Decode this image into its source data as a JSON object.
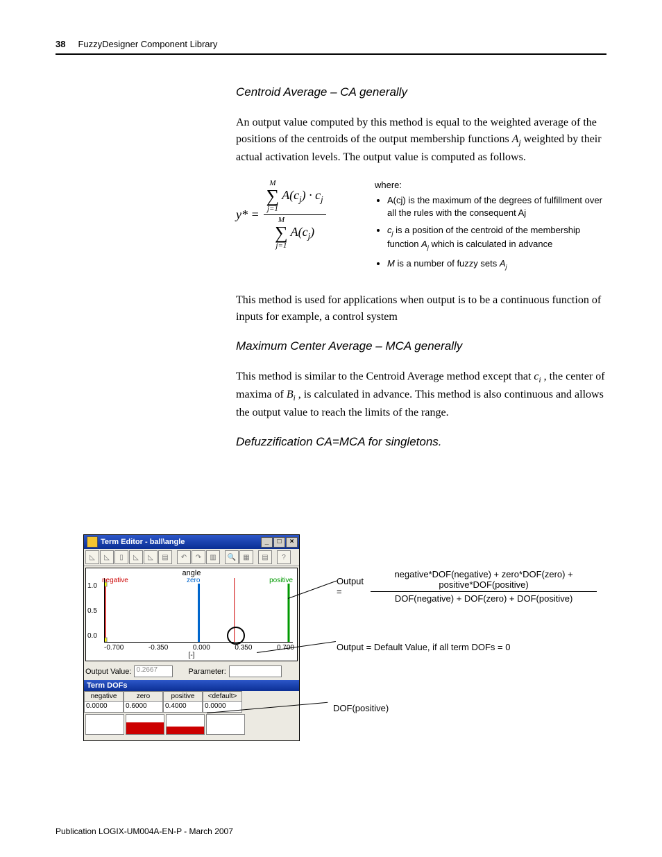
{
  "header": {
    "page": "38",
    "title": "FuzzyDesigner Component Library"
  },
  "s1": {
    "head": "Centroid Average – CA generally",
    "p1a": "An output value computed by this method is equal to the weighted average of the positions of the centroids of the output membership functions ",
    "p1b": " weighted by their actual activation levels. The output value is computed as follows.",
    "aj": "A",
    "ajsub": "j"
  },
  "formula": {
    "ystar": "y* =",
    "sumtop": "M",
    "sumbot": "j=1",
    "num": ") · c",
    "den": ")",
    "Ac": "A(c",
    "sub": "j"
  },
  "where": {
    "lbl": "where:",
    "b1": "A(cj) is the maximum of the degrees of fulfillment over all the rules with the consequent Aj",
    "b2a": "c",
    "b2b": " is a position of the centroid of the membership function ",
    "b2c": "A",
    "b2d": " which is calculated in advance",
    "sub": "j",
    "b3a": "M",
    "b3b": " is a number of fuzzy sets ",
    "b3c": "A",
    "b3sub": "j"
  },
  "s1b": {
    "p": "This method is used for applications when output is to be a continuous function of inputs for example, a control system"
  },
  "s2": {
    "head": "Maximum Center Average – MCA generally",
    "p_a": "This method is similar to the Centroid Average method except that ",
    "ci": "c",
    "cisub": "i",
    "p_b": " , the center of maxima of ",
    "bi": "B",
    "bisub": "i",
    "p_c": " , is calculated in advance. This method is also continuous and allows the output value to reach the limits of the range."
  },
  "s3": {
    "head": "Defuzzification CA=MCA for singletons."
  },
  "win": {
    "title": "Term Editor - ball\\angle",
    "chart_title": "angle",
    "terms": {
      "neg": "negative",
      "zero": "zero",
      "pos": "positive"
    },
    "y": {
      "y1": "1.0",
      "y05": "0.5",
      "y0": "0.0"
    },
    "x": {
      "x1": "-0.700",
      "x2": "-0.350",
      "x3": "0.000",
      "x4": "0.350",
      "x5": "0.700"
    },
    "xunit": "[-]",
    "ov_lbl": "Output Value:",
    "ov": "0.2667",
    "param_lbl": "Parameter:",
    "dofhdr": "Term DOFs",
    "dof": {
      "h1": "negative",
      "h2": "zero",
      "h3": "positive",
      "h4": "<default>",
      "v1": "0.0000",
      "v2": "0.6000",
      "v3": "0.4000",
      "v4": "0.0000"
    }
  },
  "ann": {
    "out_lbl": "Output =",
    "frac_top": "negative*DOF(negative) + zero*DOF(zero) + positive*DOF(positive)",
    "frac_bot": "DOF(negative) + DOF(zero) + DOF(positive)",
    "default": "Output = Default Value, if all term DOFs = 0",
    "dofpos": "DOF(positive)"
  },
  "footer": "Publication LOGIX-UM004A-EN-P - March 2007"
}
